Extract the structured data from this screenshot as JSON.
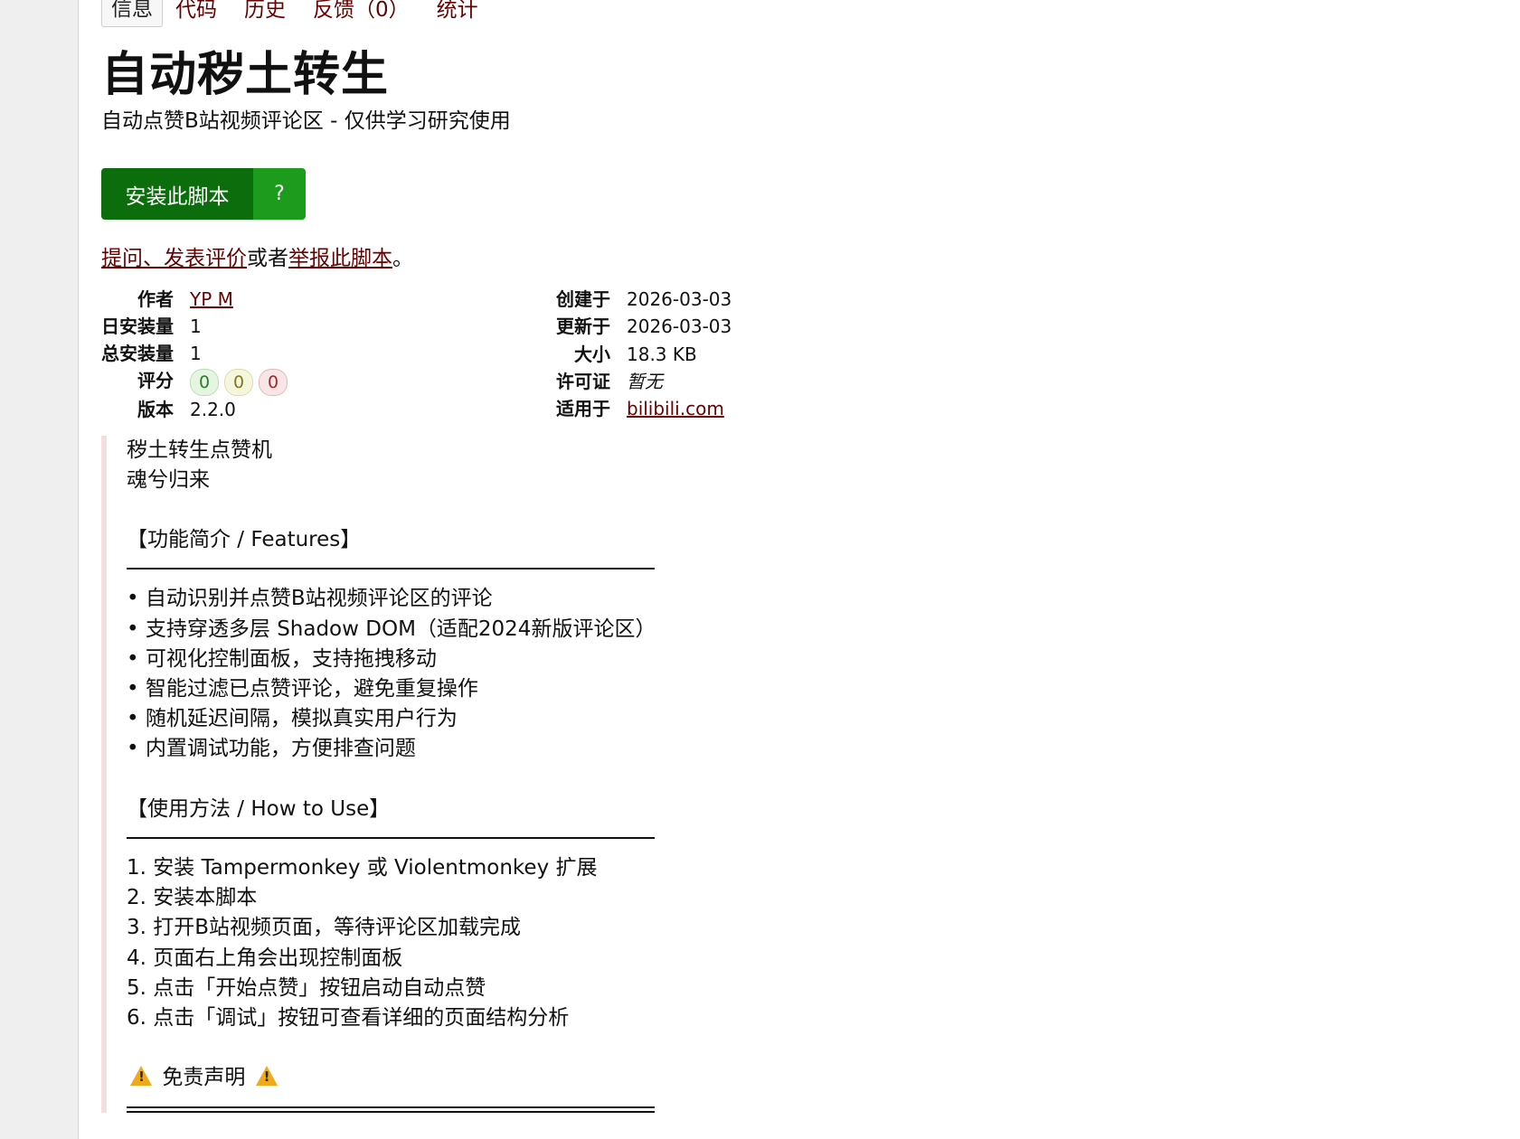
{
  "tabs": [
    {
      "label": "信息",
      "active": true
    },
    {
      "label": "代码"
    },
    {
      "label": "历史"
    },
    {
      "label": "反馈（0）"
    },
    {
      "label": "统计"
    }
  ],
  "script": {
    "title": "自动秽土转生",
    "subtitle": "自动点赞B站视频评论区 - 仅供学习研究使用",
    "install_label": "安装此脚本",
    "install_help": "?"
  },
  "feedback": {
    "ask_link": "提问、发表评价",
    "middle": "或者",
    "report_link": "举报此脚本",
    "end": "。"
  },
  "info": {
    "left": [
      {
        "label": "作者",
        "value": "YP M"
      },
      {
        "label": "日安装量",
        "value": "1"
      },
      {
        "label": "总安装量",
        "value": "1"
      },
      {
        "label": "评分",
        "value": ""
      },
      {
        "label": "版本",
        "value": "2.2.0"
      }
    ],
    "right": [
      {
        "label": "创建于",
        "value": "2026-03-03"
      },
      {
        "label": "更新于",
        "value": "2026-03-03"
      },
      {
        "label": "大小",
        "value": "18.3 KB"
      },
      {
        "label": "许可证",
        "value": "暂无"
      },
      {
        "label": "适用于",
        "value": "bilibili.com"
      }
    ],
    "ratings": {
      "good": "0",
      "ok": "0",
      "bad": "0"
    }
  },
  "description": {
    "intro": [
      "秽土转生点赞机",
      "魂兮归来"
    ],
    "features_heading": "【功能简介 / Features】",
    "features": [
      "• 自动识别并点赞B站视频评论区的评论",
      "• 支持穿透多层 Shadow DOM（适配2024新版评论区）",
      "• 可视化控制面板，支持拖拽移动",
      "• 智能过滤已点赞评论，避免重复操作",
      "• 随机延迟间隔，模拟真实用户行为",
      "• 内置调试功能，方便排查问题"
    ],
    "howto_heading": "【使用方法 / How to Use】",
    "howto": [
      "1. 安装 Tampermonkey 或 Violentmonkey 扩展",
      "2. 安装本脚本",
      "3. 打开B站视频页面，等待评论区加载完成",
      "4. 页面右上角会出现控制面板",
      "5. 点击「开始点赞」按钮启动自动点赞",
      "6. 点击「调试」按钮可查看详细的页面结构分析"
    ],
    "disclaimer_heading": "免责声明"
  }
}
